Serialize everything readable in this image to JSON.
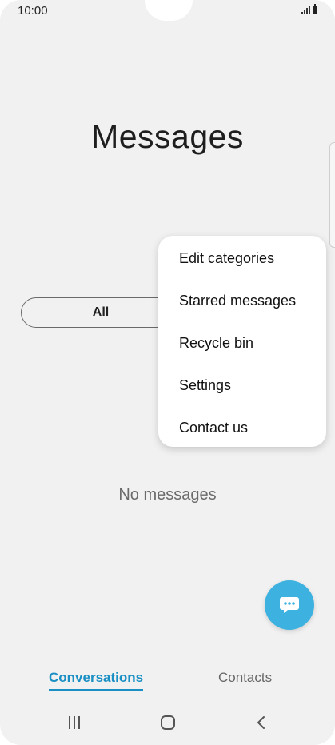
{
  "status_bar": {
    "time": "10:00"
  },
  "header": {
    "title": "Messages"
  },
  "filter": {
    "all_label": "All"
  },
  "menu": {
    "items": [
      {
        "label": "Edit categories"
      },
      {
        "label": "Starred messages"
      },
      {
        "label": "Recycle bin"
      },
      {
        "label": "Settings"
      },
      {
        "label": "Contact us"
      }
    ]
  },
  "main": {
    "empty_text": "No messages"
  },
  "tabs": [
    {
      "label": "Conversations",
      "active": true
    },
    {
      "label": "Contacts",
      "active": false
    }
  ],
  "colors": {
    "accent": "#1a8fc4",
    "fab": "#3db2e0",
    "background": "#f1f1f1"
  },
  "icons": {
    "fab": "chat-bubble-icon",
    "nav": [
      "recent-apps-icon",
      "home-icon",
      "back-icon"
    ]
  }
}
